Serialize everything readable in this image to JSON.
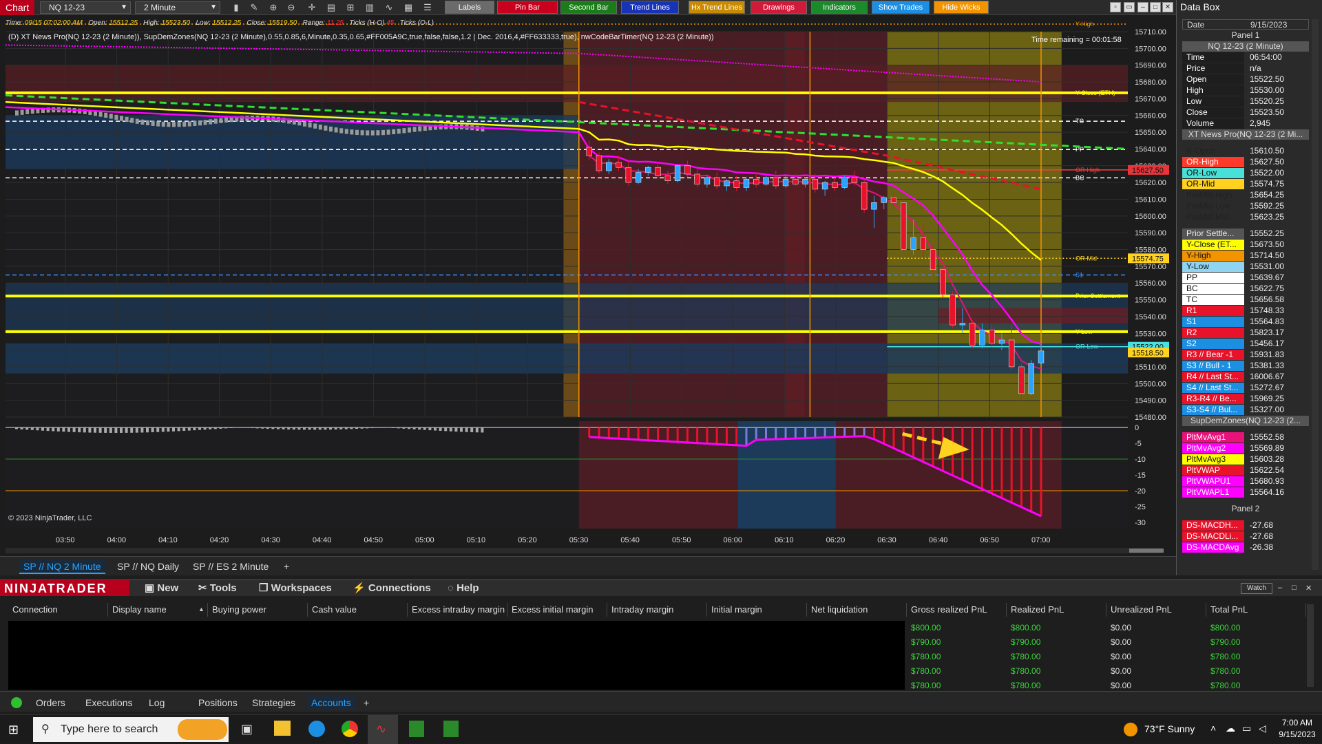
{
  "toolbar": {
    "title": "Chart",
    "instrument": "NQ 12-23",
    "interval": "2 Minute",
    "buttons": [
      {
        "label": "Labels",
        "color": "#6b6b6b"
      },
      {
        "label": "Pin Bar",
        "color": "#c8001e"
      },
      {
        "label": "Second Bar",
        "color": "#1a7d1a"
      },
      {
        "label": "Trend Lines",
        "color": "#1733b8"
      },
      {
        "label": "Hx Trend Lines",
        "color": "#c88a00"
      },
      {
        "label": "Drawings",
        "color": "#d01a3a"
      },
      {
        "label": "Indicators",
        "color": "#1a8a2a"
      },
      {
        "label": "Show Trades",
        "color": "#1d8fe3"
      },
      {
        "label": "Hide Wicks",
        "color": "#f29400"
      }
    ]
  },
  "info": {
    "time_label": "Time:",
    "time": "09/15 07:02:00 AM",
    "open_label": "Open:",
    "open": "15512.25",
    "high_label": "High:",
    "high": "15523.50",
    "low_label": "Low:",
    "low": "15512.25",
    "close_label": "Close:",
    "close": "15519.50",
    "range_label": "Range:",
    "range": "11.25",
    "ticksHO_label": "Ticks (H-O)",
    "ticksHO": "45",
    "ticksOL_label": "Ticks (O-L)"
  },
  "study_line": "(D) XT News Pro(NQ 12-23 (2 Minute)), SupDemZones(NQ 12-23 (2 Minute),0.55,0.85,6,Minute,0.35,0.65,#FF005A9C,true,false,false,1.2 | Dec. 2016,4,#FF633333,true), nwCodeBarTimer(NQ 12-23 (2 Minute))",
  "time_remaining": "Time remaining = 00:01:58",
  "copyright": "© 2023 NinjaTrader, LLC",
  "chart_data": {
    "type": "candlestick",
    "instrument": "NQ 12-23",
    "interval": "2 Minute",
    "price_axis": {
      "min": 15480,
      "max": 15710,
      "ticks": [
        15710,
        15700,
        15690,
        15680,
        15670,
        15660,
        15650,
        15640,
        15630,
        15620,
        15610,
        15600,
        15590,
        15580,
        15570,
        15560,
        15550,
        15540,
        15530,
        15520,
        15510,
        15500,
        15490,
        15480
      ]
    },
    "time_axis": {
      "labels": [
        "03:50",
        "04:00",
        "04:10",
        "04:20",
        "04:30",
        "04:40",
        "04:50",
        "05:00",
        "05:10",
        "05:20",
        "05:30",
        "05:40",
        "05:50",
        "06:00",
        "06:10",
        "06:20",
        "06:30",
        "06:40",
        "06:50",
        "07:00"
      ]
    },
    "price_flags": [
      {
        "value": "15627.50",
        "price": 15627.5,
        "color": "#e8343a"
      },
      {
        "value": "15574.75",
        "price": 15574.75,
        "color": "#ffd21f"
      },
      {
        "value": "15522.00",
        "price": 15522,
        "color": "#49e0e0"
      },
      {
        "value": "15518.50",
        "price": 15518.5,
        "color": "#ffd21f"
      }
    ],
    "levels": [
      {
        "name": "Y-High",
        "price": 15714.5,
        "color": "#f29400",
        "style": "dotted"
      },
      {
        "name": "Y-Close (ETH)",
        "price": 15673.5,
        "color": "#ffff00",
        "style": "solid"
      },
      {
        "name": "TC",
        "price": 15656.58,
        "color": "#ffffff",
        "style": "dashed"
      },
      {
        "name": "PP",
        "price": 15639.67,
        "color": "#ffffff",
        "style": "dashed"
      },
      {
        "name": "OR-High",
        "price": 15627.5,
        "color": "#ff3a3a",
        "style": "solid"
      },
      {
        "name": "BC",
        "price": 15622.75,
        "color": "#ffffff",
        "style": "dashed"
      },
      {
        "name": "OR-Mid",
        "price": 15574.75,
        "color": "#ffd21f",
        "style": "dotted"
      },
      {
        "name": "S1",
        "price": 15564.83,
        "color": "#3a8fff",
        "style": "dashed"
      },
      {
        "name": "Prior Settlement",
        "price": 15552.25,
        "color": "#ffff00",
        "style": "solid"
      },
      {
        "name": "Y-Low",
        "price": 15531,
        "color": "#ffff00",
        "style": "solid"
      },
      {
        "name": "OR-Low",
        "price": 15522,
        "color": "#49e0e0",
        "style": "solid"
      }
    ],
    "moving_averages": [
      {
        "name": "PltMvAvg1",
        "value": 15552.58,
        "color": "#e8127a"
      },
      {
        "name": "PltMvAvg2",
        "value": 15569.89,
        "color": "#ff00ff"
      },
      {
        "name": "PltMvAvg3",
        "value": 15603.28,
        "color": "#ffff00"
      }
    ],
    "candles": [
      {
        "o": 15641,
        "h": 15645,
        "c": 15636,
        "l": 15633
      },
      {
        "o": 15636,
        "h": 15638,
        "c": 15627,
        "l": 15625
      },
      {
        "o": 15627,
        "h": 15634,
        "c": 15632,
        "l": 15625
      },
      {
        "o": 15632,
        "h": 15636,
        "c": 15629,
        "l": 15627
      },
      {
        "o": 15629,
        "h": 15633,
        "c": 15620,
        "l": 15618
      },
      {
        "o": 15620,
        "h": 15628,
        "c": 15626,
        "l": 15619
      },
      {
        "o": 15626,
        "h": 15630,
        "c": 15629,
        "l": 15624
      },
      {
        "o": 15629,
        "h": 15632,
        "c": 15624,
        "l": 15622
      },
      {
        "o": 15624,
        "h": 15627,
        "c": 15621,
        "l": 15619
      },
      {
        "o": 15621,
        "h": 15631,
        "c": 15630,
        "l": 15620
      },
      {
        "o": 15630,
        "h": 15633,
        "c": 15625,
        "l": 15623
      },
      {
        "o": 15625,
        "h": 15628,
        "c": 15619,
        "l": 15617
      },
      {
        "o": 15619,
        "h": 15624,
        "c": 15623,
        "l": 15617
      },
      {
        "o": 15623,
        "h": 15626,
        "c": 15618,
        "l": 15616
      },
      {
        "o": 15618,
        "h": 15622,
        "c": 15621,
        "l": 15615
      },
      {
        "o": 15621,
        "h": 15624,
        "c": 15617,
        "l": 15615
      },
      {
        "o": 15617,
        "h": 15623,
        "c": 15622,
        "l": 15615
      },
      {
        "o": 15622,
        "h": 15626,
        "c": 15619,
        "l": 15617
      },
      {
        "o": 15619,
        "h": 15624,
        "c": 15623,
        "l": 15618
      },
      {
        "o": 15623,
        "h": 15627,
        "c": 15618,
        "l": 15616
      },
      {
        "o": 15618,
        "h": 15624,
        "c": 15622,
        "l": 15617
      },
      {
        "o": 15622,
        "h": 15625,
        "c": 15619,
        "l": 15618
      },
      {
        "o": 15619,
        "h": 15623,
        "c": 15622,
        "l": 15617
      },
      {
        "o": 15622,
        "h": 15625,
        "c": 15616,
        "l": 15614
      },
      {
        "o": 15616,
        "h": 15621,
        "c": 15620,
        "l": 15612
      },
      {
        "o": 15620,
        "h": 15623,
        "c": 15617,
        "l": 15615
      },
      {
        "o": 15617,
        "h": 15624,
        "c": 15623,
        "l": 15616
      },
      {
        "o": 15623,
        "h": 15627,
        "c": 15620,
        "l": 15618
      },
      {
        "o": 15620,
        "h": 15622,
        "c": 15604,
        "l": 15602
      },
      {
        "o": 15604,
        "h": 15612,
        "c": 15608,
        "l": 15593
      },
      {
        "o": 15608,
        "h": 15612,
        "c": 15611,
        "l": 15604
      },
      {
        "o": 15611,
        "h": 15614,
        "c": 15608,
        "l": 15605
      },
      {
        "o": 15608,
        "h": 15610,
        "c": 15580,
        "l": 15578
      },
      {
        "o": 15580,
        "h": 15598,
        "c": 15587,
        "l": 15577
      },
      {
        "o": 15587,
        "h": 15595,
        "c": 15580,
        "l": 15574
      },
      {
        "o": 15580,
        "h": 15583,
        "c": 15568,
        "l": 15566
      },
      {
        "o": 15568,
        "h": 15570,
        "c": 15553,
        "l": 15551
      },
      {
        "o": 15553,
        "h": 15555,
        "c": 15535,
        "l": 15533
      },
      {
        "o": 15535,
        "h": 15545,
        "c": 15536,
        "l": 15530
      },
      {
        "o": 15536,
        "h": 15538,
        "c": 15523,
        "l": 15521
      },
      {
        "o": 15523,
        "h": 15536,
        "c": 15532,
        "l": 15521
      },
      {
        "o": 15532,
        "h": 15535,
        "c": 15524,
        "l": 15522
      },
      {
        "o": 15524,
        "h": 15530,
        "c": 15526,
        "l": 15520
      },
      {
        "o": 15526,
        "h": 15535,
        "c": 15510,
        "l": 15508
      },
      {
        "o": 15510,
        "h": 15512,
        "c": 15494,
        "l": 15490
      },
      {
        "o": 15494,
        "h": 15514,
        "c": 15512,
        "l": 15493
      },
      {
        "o": 15512.25,
        "h": 15523.5,
        "c": 15519.5,
        "l": 15512.25
      }
    ],
    "macd_panel": {
      "y_axis": {
        "min": -32,
        "max": 2,
        "ticks": [
          0,
          -5,
          -10,
          -15,
          -20,
          -25,
          -30
        ]
      },
      "value": -27.68
    }
  },
  "chart_tabs": [
    "SP // NQ  2 Minute",
    "SP // NQ  Daily",
    "SP // ES  2 Minute"
  ],
  "chart_tabs_add": "+",
  "databox": {
    "title": "Data Box",
    "date_label": "Date",
    "date": "9/15/2023",
    "panel1": "Panel 1",
    "instrument_row": "NQ 12-23 (2 Minute)",
    "ohlc": [
      {
        "label": "Time",
        "value": "06:54:00"
      },
      {
        "label": "Price",
        "value": "n/a"
      },
      {
        "label": "Open",
        "value": "15522.50"
      },
      {
        "label": "High",
        "value": "15530.00"
      },
      {
        "label": "Low",
        "value": "15520.25"
      },
      {
        "label": "Close",
        "value": "15523.50"
      },
      {
        "label": "Volume",
        "value": "2,945"
      }
    ],
    "xt_header": "XT News Pro(NQ 12-23 (2 Mi...",
    "levels": [
      {
        "label": "R-Open",
        "value": "15610.50",
        "bg": "#2a2a2a",
        "fg": "#222"
      },
      {
        "label": "OR-High",
        "value": "15627.50",
        "bg": "#ff3a2a",
        "fg": "#fff"
      },
      {
        "label": "OR-Low",
        "value": "15522.00",
        "bg": "#49e0d8",
        "fg": "#111"
      },
      {
        "label": "OR-Mid",
        "value": "15574.75",
        "bg": "#ffd21f",
        "fg": "#111"
      },
      {
        "label": "PreMkt-High",
        "value": "15654.25",
        "bg": "#2a2a2a",
        "fg": "#222"
      },
      {
        "label": "PreMkt-Low",
        "value": "15592.25",
        "bg": "#2a2a2a",
        "fg": "#222"
      },
      {
        "label": "PreMkt-Mid",
        "value": "15623.25",
        "bg": "#2a2a2a",
        "fg": "#222"
      }
    ],
    "pivots": [
      {
        "label": "Prior Settle...",
        "value": "15552.25",
        "bg": "#555",
        "fg": "#eee"
      },
      {
        "label": "Y-Close (ET...",
        "value": "15673.50",
        "bg": "#ffff00",
        "fg": "#111"
      },
      {
        "label": "Y-High",
        "value": "15714.50",
        "bg": "#f29400",
        "fg": "#111"
      },
      {
        "label": "Y-Low",
        "value": "15531.00",
        "bg": "#8fd4f2",
        "fg": "#111"
      },
      {
        "label": "PP",
        "value": "15639.67",
        "bg": "#ffffff",
        "fg": "#111"
      },
      {
        "label": "BC",
        "value": "15622.75",
        "bg": "#ffffff",
        "fg": "#111"
      },
      {
        "label": "TC",
        "value": "15656.58",
        "bg": "#ffffff",
        "fg": "#111"
      },
      {
        "label": "R1",
        "value": "15748.33",
        "bg": "#e8122a",
        "fg": "#fff"
      },
      {
        "label": "S1",
        "value": "15564.83",
        "bg": "#1d8fe3",
        "fg": "#fff"
      },
      {
        "label": "R2",
        "value": "15823.17",
        "bg": "#e8122a",
        "fg": "#fff"
      },
      {
        "label": "S2",
        "value": "15456.17",
        "bg": "#1d8fe3",
        "fg": "#fff"
      },
      {
        "label": "R3 // Bear -1",
        "value": "15931.83",
        "bg": "#e8122a",
        "fg": "#fff"
      },
      {
        "label": "S3 // Bull - 1",
        "value": "15381.33",
        "bg": "#1d8fe3",
        "fg": "#fff"
      },
      {
        "label": "R4 // Last St...",
        "value": "16006.67",
        "bg": "#e8122a",
        "fg": "#fff"
      },
      {
        "label": "S4 // Last St...",
        "value": "15272.67",
        "bg": "#1d8fe3",
        "fg": "#fff"
      },
      {
        "label": "R3-R4 // Be...",
        "value": "15969.25",
        "bg": "#e8122a",
        "fg": "#fff"
      },
      {
        "label": "S3-S4 // Bul...",
        "value": "15327.00",
        "bg": "#1d8fe3",
        "fg": "#fff"
      }
    ],
    "supdem_header": "SupDemZones(NQ 12-23 (2...",
    "mas": [
      {
        "label": "PltMvAvg1",
        "value": "15552.58",
        "bg": "#e8127a",
        "fg": "#fff"
      },
      {
        "label": "PltMvAvg2",
        "value": "15569.89",
        "bg": "#ff00ff",
        "fg": "#fff"
      },
      {
        "label": "PltMvAvg3",
        "value": "15603.28",
        "bg": "#ffff00",
        "fg": "#111"
      },
      {
        "label": "PltVWAP",
        "value": "15622.54",
        "bg": "#e8122a",
        "fg": "#fff"
      },
      {
        "label": "PltVWAPU1",
        "value": "15680.93",
        "bg": "#ff00ff",
        "fg": "#fff"
      },
      {
        "label": "PltVWAPL1",
        "value": "15564.16",
        "bg": "#ff00ff",
        "fg": "#fff"
      }
    ],
    "panel2": "Panel 2",
    "macd": [
      {
        "label": "DS-MACDH...",
        "value": "-27.68",
        "bg": "#e8122a",
        "fg": "#fff"
      },
      {
        "label": "DS-MACDLi...",
        "value": "-27.68",
        "bg": "#e8122a",
        "fg": "#fff"
      },
      {
        "label": "DS-MACDAvg",
        "value": "-26.38",
        "bg": "#ff00ff",
        "fg": "#fff"
      }
    ]
  },
  "nt_bar": {
    "logo": "NINJATRADER",
    "menu": [
      "New",
      "Tools",
      "Workspaces",
      "Connections",
      "Help"
    ],
    "watch": "Watch"
  },
  "accounts": {
    "columns": [
      "Connection",
      "Display name",
      "Buying power",
      "Cash value",
      "Excess intraday margin",
      "Excess initial margin",
      "Intraday margin",
      "Initial margin",
      "Net liquidation",
      "Gross realized PnL",
      "Realized PnL",
      "Unrealized PnL",
      "Total PnL"
    ],
    "rows": [
      {
        "gross": "$800.00",
        "realized": "$800.00",
        "unrealized": "$0.00",
        "total": "$800.00"
      },
      {
        "gross": "$790.00",
        "realized": "$790.00",
        "unrealized": "$0.00",
        "total": "$790.00"
      },
      {
        "gross": "$780.00",
        "realized": "$780.00",
        "unrealized": "$0.00",
        "total": "$780.00"
      },
      {
        "gross": "$780.00",
        "realized": "$780.00",
        "unrealized": "$0.00",
        "total": "$780.00"
      },
      {
        "gross": "$780.00",
        "realized": "$780.00",
        "unrealized": "$0.00",
        "total": "$780.00"
      }
    ]
  },
  "bottom_tabs": [
    "Orders",
    "Executions",
    "Log",
    "Positions",
    "Strategies",
    "Accounts"
  ],
  "bottom_tabs_add": "+",
  "taskbar": {
    "search_placeholder": "Type here to search",
    "weather": "73°F  Sunny",
    "time": "7:00 AM",
    "date": "9/15/2023"
  }
}
